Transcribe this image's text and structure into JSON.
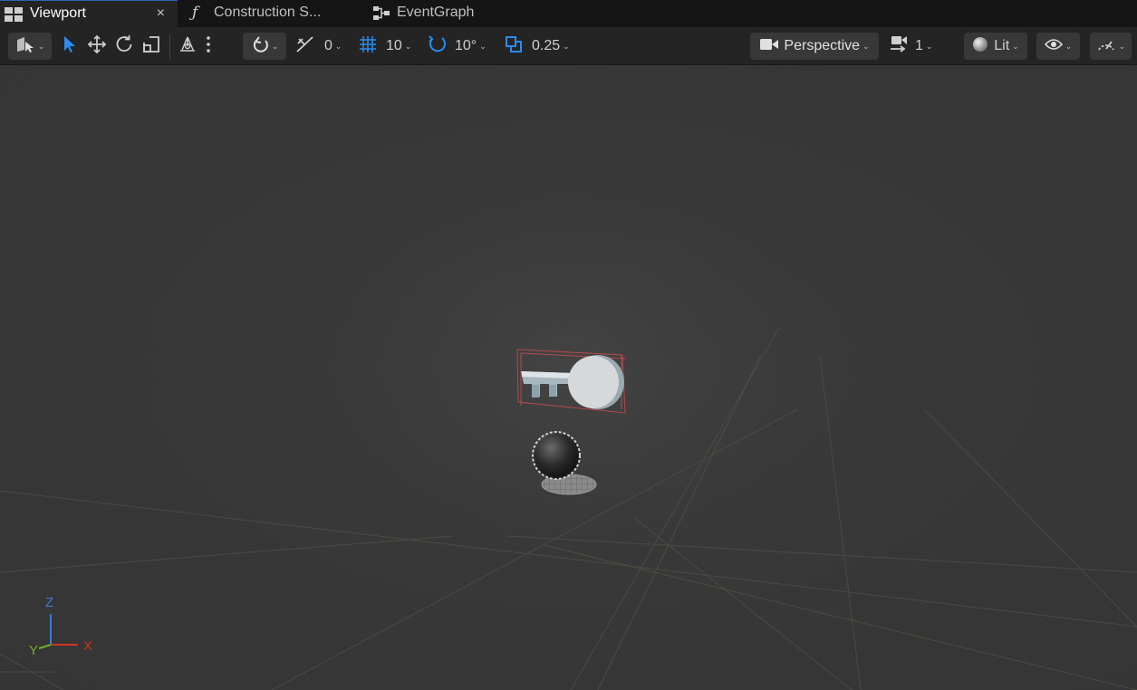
{
  "tabs": [
    {
      "label": "Viewport",
      "active": true,
      "icon": "viewport-layout-icon",
      "close": "×"
    },
    {
      "label": "Construction S...",
      "active": false,
      "icon": "function-icon",
      "glyph": "ƒ"
    },
    {
      "label": "EventGraph",
      "active": false,
      "icon": "graph-icon"
    }
  ],
  "toolbar": {
    "select_mode_icon": "select-mode-icon",
    "transform_tools": [
      "select-arrow-icon",
      "move-icon",
      "rotate-icon",
      "scale-icon"
    ],
    "surface_snap_icon": "surface-snap-icon",
    "more_icon": "kebab-menu-icon",
    "realtime_icon": "snap-toggle-icon",
    "snap_offset": "0",
    "grid_snap": "10",
    "rotation_snap": "10°",
    "scale_snap": "0.25",
    "view_mode": "Perspective",
    "layout": "1",
    "lighting": "Lit",
    "show_icon": "eye-icon",
    "perf_icon": "performance-gauge-icon"
  },
  "axis": {
    "z": "Z",
    "x": "X",
    "y": "Y",
    "colors": {
      "z": "#3a7bd5",
      "x": "#d0331f",
      "y": "#6fae2a"
    }
  },
  "colors": {
    "accent": "#2a8cf0",
    "active_tab_border": "#2a65b8",
    "bounds": "#b44a4a"
  }
}
